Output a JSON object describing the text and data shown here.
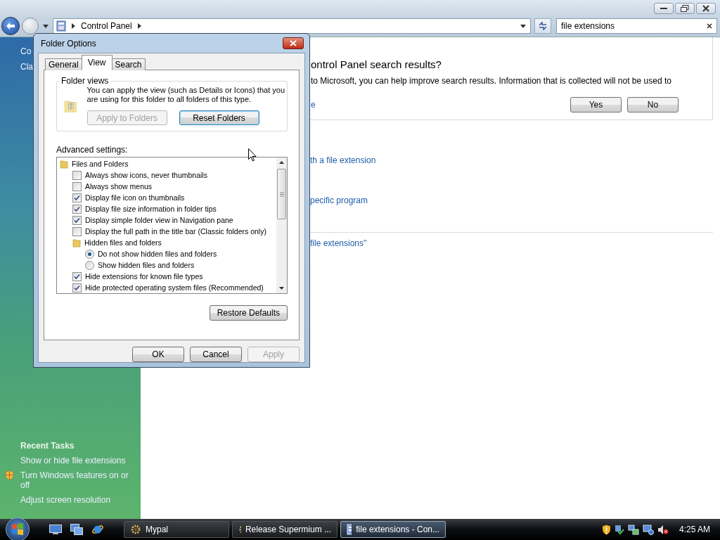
{
  "window": {
    "address": "Control Panel",
    "search": "file extensions"
  },
  "sidebar": {
    "partial_links": [
      "Co",
      "Cla"
    ],
    "recent_tasks": {
      "title": "Recent Tasks",
      "items": [
        {
          "label": "Show or hide file extensions",
          "shield": false
        },
        {
          "label": "Turn Windows features on or off",
          "shield": true
        },
        {
          "label": "Adjust screen resolution",
          "shield": false
        }
      ]
    }
  },
  "content": {
    "feedback": {
      "title": "ontrol Panel search results?",
      "text": "to Microsoft, you can help improve search results. Information that is collected will not be used to",
      "link": "e",
      "buttons": [
        "Yes",
        "No"
      ]
    },
    "results": [
      "th a file extension",
      "pecific program"
    ],
    "search_link": "file extensions\""
  },
  "dialog": {
    "title": "Folder Options",
    "tabs": [
      {
        "label": "General",
        "selected": false
      },
      {
        "label": "View",
        "selected": true
      },
      {
        "label": "Search",
        "selected": false
      }
    ],
    "folder_views": {
      "title": "Folder views",
      "text": "You can apply the view (such as Details or Icons) that you are using for this folder to all folders of this type.",
      "buttons": [
        {
          "label": "Apply to Folders",
          "disabled": true,
          "focused": false
        },
        {
          "label": "Reset Folders",
          "disabled": false,
          "focused": true
        }
      ]
    },
    "advanced_label": "Advanced settings:",
    "tree": [
      {
        "kind": "folder",
        "label": "Files and Folders",
        "children": [
          {
            "kind": "checkbox",
            "label": "Always show icons, never thumbnails",
            "checked": false
          },
          {
            "kind": "checkbox",
            "label": "Always show menus",
            "checked": false
          },
          {
            "kind": "checkbox",
            "label": "Display file icon on thumbnails",
            "checked": true
          },
          {
            "kind": "checkbox",
            "label": "Display file size information in folder tips",
            "checked": true
          },
          {
            "kind": "checkbox",
            "label": "Display simple folder view in Navigation pane",
            "checked": true
          },
          {
            "kind": "checkbox",
            "label": "Display the full path in the title bar (Classic folders only)",
            "checked": false
          },
          {
            "kind": "folder",
            "label": "Hidden files and folders",
            "children": [
              {
                "kind": "radio",
                "label": "Do not show hidden files and folders",
                "selected": true
              },
              {
                "kind": "radio",
                "label": "Show hidden files and folders",
                "selected": false
              }
            ]
          },
          {
            "kind": "checkbox",
            "label": "Hide extensions for known file types",
            "checked": true
          },
          {
            "kind": "checkbox",
            "label": "Hide protected operating system files (Recommended)",
            "checked": true
          }
        ]
      }
    ],
    "restore_button": "Restore Defaults",
    "buttons": [
      {
        "label": "OK",
        "disabled": false
      },
      {
        "label": "Cancel",
        "disabled": false
      },
      {
        "label": "Apply",
        "disabled": true
      }
    ]
  },
  "taskbar": {
    "tasks": [
      {
        "label": "Mypal",
        "selected": false,
        "kind": "app"
      },
      {
        "label": "Release Supermium ...",
        "selected": false,
        "kind": "app"
      },
      {
        "label": "file extensions - Con...",
        "selected": true,
        "kind": "panel"
      }
    ],
    "clock": "4:25 AM"
  }
}
